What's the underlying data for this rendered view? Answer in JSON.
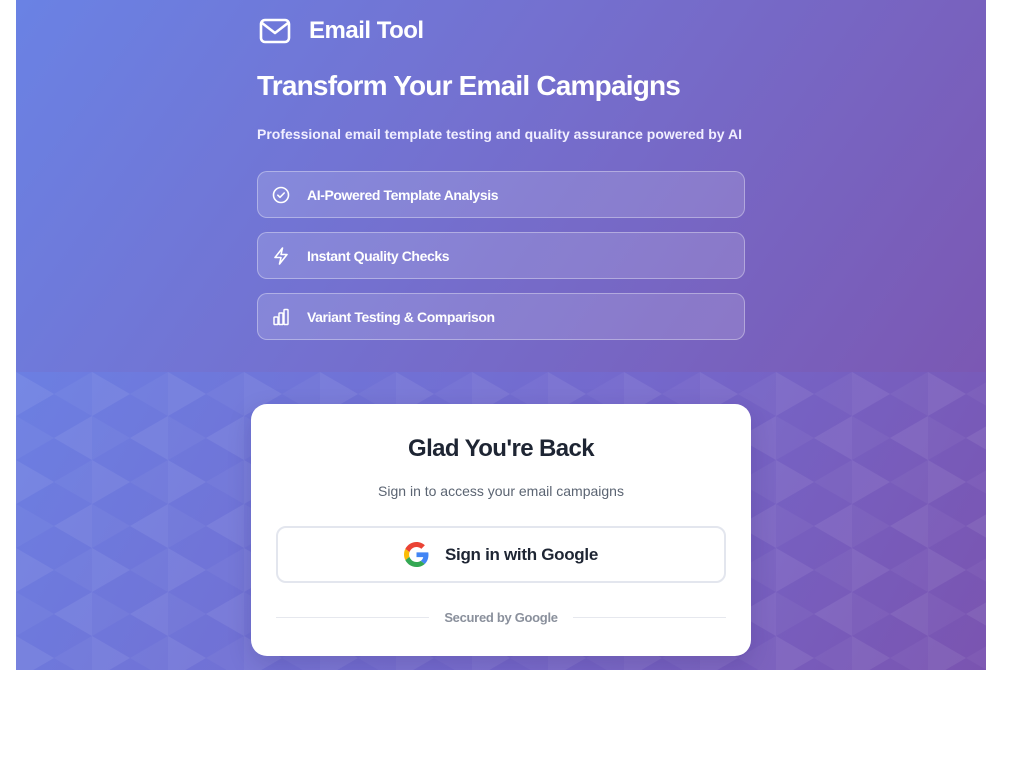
{
  "app": {
    "brand_name": "Email Tool",
    "brand_icon": "mail-icon"
  },
  "hero": {
    "headline": "Transform Your Email Campaigns",
    "subline": "Professional email template testing and quality assurance powered by AI",
    "features": [
      {
        "label": "AI-Powered Template Analysis",
        "icon": "check-circle-icon"
      },
      {
        "label": "Instant Quality Checks",
        "icon": "lightning-bolt-icon"
      },
      {
        "label": "Variant Testing & Comparison",
        "icon": "bar-chart-icon"
      }
    ]
  },
  "login": {
    "title": "Glad You're Back",
    "subtitle": "Sign in to access your email campaigns",
    "google_button_label": "Sign in with Google",
    "google_icon": "google-g-icon",
    "secured_text": "Secured by Google"
  },
  "colors": {
    "gradient_start": "#6a82e4",
    "gradient_end": "#7b58b3",
    "card_background": "#ffffff",
    "title_text": "#1e2533",
    "muted_text": "#5b6472",
    "divider_text": "#8a909c",
    "google_blue": "#4285F4",
    "google_red": "#EA4335",
    "google_yellow": "#FBBC05",
    "google_green": "#34A853"
  }
}
